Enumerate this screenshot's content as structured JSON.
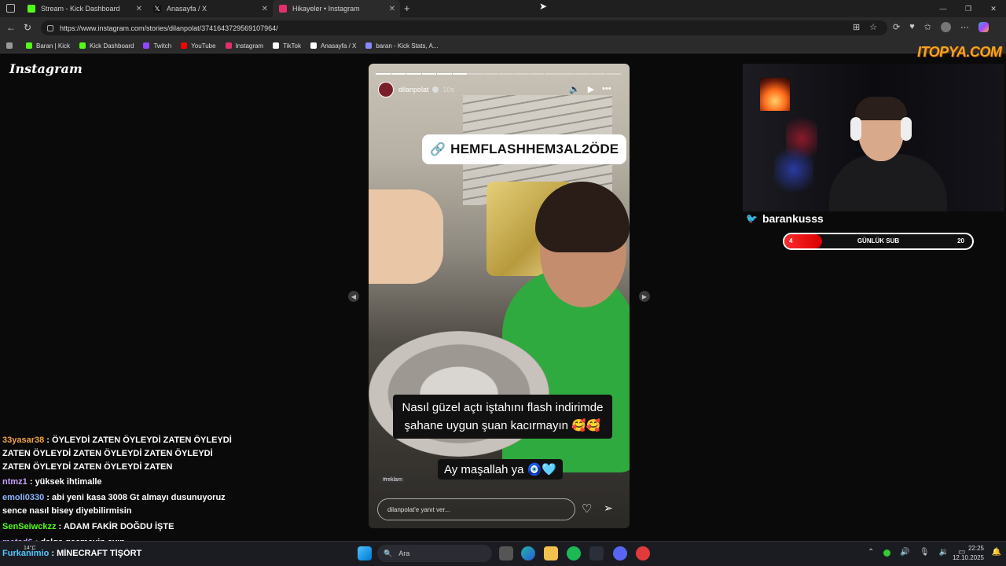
{
  "browser": {
    "tabs": [
      {
        "title": "Stream - Kick Dashboard",
        "color": "#53fc18",
        "active": false
      },
      {
        "title": "Anasayfa / X",
        "color": "#ffffff",
        "active": false
      },
      {
        "title": "Hikayeler • Instagram",
        "color": "#e1306c",
        "active": true
      }
    ],
    "new_tab": "+",
    "url": "https://www.instagram.com/stories/dilanpolat/3741643729569107964/",
    "bookmarks": [
      {
        "label": "Baran | Kick",
        "color": "#53fc18"
      },
      {
        "label": "Kick Dashboard",
        "color": "#53fc18"
      },
      {
        "label": "Twitch",
        "color": "#9146ff"
      },
      {
        "label": "YouTube",
        "color": "#ff0000"
      },
      {
        "label": "Instagram",
        "color": "#e1306c"
      },
      {
        "label": "TikTok",
        "color": "#ffffff"
      },
      {
        "label": "Anasayfa / X",
        "color": "#ffffff"
      },
      {
        "label": "baran - Kick Stats, A...",
        "color": "#8888ff"
      }
    ]
  },
  "instagram": {
    "logo": "Instagram",
    "story": {
      "username": "dilanpolat",
      "time": "10s",
      "link_sticker": "HEMFLASHHEM3AL2ÖDE",
      "caption1": "Nasıl güzel açtı iştahını flash indirimde şahane uygun şuan kacırmayın 🥰🥰",
      "caption2": "Ay maşallah ya 🧿🩵",
      "ad_tag": "#reklam",
      "reply_placeholder": "dilanpolat'e yanıt ver...",
      "progress_segments": 16,
      "progress_done": 6
    }
  },
  "overlay": {
    "brand": "ITOPYA.COM",
    "twitter_handle": "barankusss",
    "sub_goal": {
      "current": "4",
      "label": "GÜNLÜK SUB",
      "target": "20",
      "fraction": 0.2
    }
  },
  "chat": [
    {
      "user": "33yasar38",
      "color": "#f0a040",
      "text": "ÖYLEYDİ ZATEN ÖYLEYDİ ZATEN ÖYLEYDİ ZATEN ÖYLEYDİ ZATEN ÖYLEYDİ ZATEN ÖYLEYDİ ZATEN ÖYLEYDİ ZATEN ÖYLEYDİ ZATEN"
    },
    {
      "user": "ntmz1",
      "color": "#c9a0ff",
      "text": "yüksek ihtimalle"
    },
    {
      "user": "emoli0330",
      "color": "#8fb4ff",
      "text": "abi yeni kasa 3008 Gt almayı dusunuyoruz sence nasıl bisey diyebilirmisin"
    },
    {
      "user": "SenSeiwckzz",
      "color": "#53fc18",
      "text": "ADAM FAKİR DOĞDU İŞTE"
    },
    {
      "user": "metad6",
      "color": "#c9a0ff",
      "text": "dalga geçmeyin ayıp"
    },
    {
      "user": "Furkanimio",
      "color": "#53c8ff",
      "text": "MİNECRAFT TİŞÖRT"
    }
  ],
  "taskbar": {
    "search": "Ara",
    "weather": "14°C",
    "time": "22:25",
    "date": "12.10.2025"
  }
}
